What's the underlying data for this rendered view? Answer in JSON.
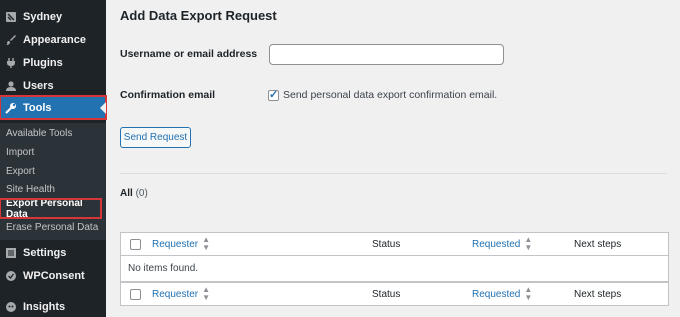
{
  "sidebar": {
    "menu": [
      {
        "label": "Sydney",
        "icon": "sydney-icon"
      },
      {
        "label": "Appearance",
        "icon": "appearance-brush-icon"
      },
      {
        "label": "Plugins",
        "icon": "plugin-icon"
      },
      {
        "label": "Users",
        "icon": "user-icon"
      },
      {
        "label": "Tools",
        "icon": "wrench-icon"
      }
    ],
    "submenu": [
      {
        "label": "Available Tools"
      },
      {
        "label": "Import"
      },
      {
        "label": "Export"
      },
      {
        "label": "Site Health"
      },
      {
        "label": "Export Personal Data"
      },
      {
        "label": "Erase Personal Data"
      }
    ],
    "bottom_menu": [
      {
        "label": "Settings",
        "icon": "settings-icon"
      },
      {
        "label": "WPConsent",
        "icon": "wpconsent-icon"
      },
      {
        "label": "Insights",
        "icon": "insights-icon"
      }
    ]
  },
  "main": {
    "title": "Add Data Export Request",
    "username_label": "Username or email address",
    "username_value": "",
    "confirmation_label": "Confirmation email",
    "confirmation_text": "Send personal data export confirmation email.",
    "send_button": "Send Request",
    "filter": {
      "label": "All",
      "count": "(0)"
    }
  },
  "table": {
    "headers": {
      "requester": "Requester",
      "status": "Status",
      "requested": "Requested",
      "next_steps": "Next steps"
    },
    "empty_message": "No items found."
  },
  "colors": {
    "accent": "#2271b1",
    "highlight": "#d63638",
    "sidebar": "#1d2327"
  }
}
